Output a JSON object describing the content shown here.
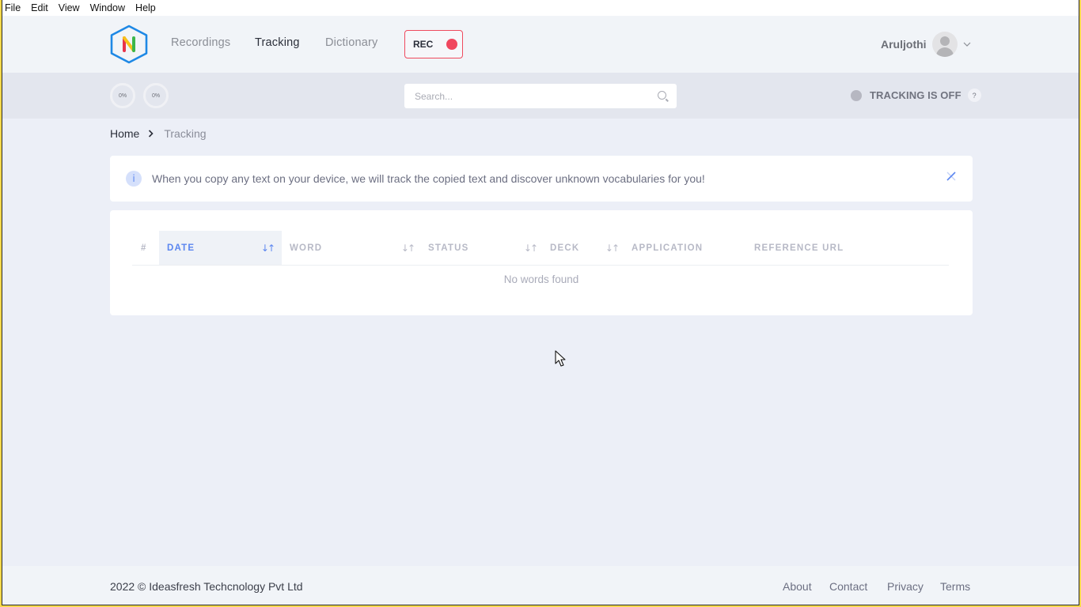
{
  "menubar": {
    "items": [
      "File",
      "Edit",
      "View",
      "Window",
      "Help"
    ]
  },
  "header": {
    "logo_letter": "N",
    "nav": [
      {
        "label": "Recordings",
        "active": false
      },
      {
        "label": "Tracking",
        "active": true
      },
      {
        "label": "Dictionary",
        "active": false
      }
    ],
    "rec_label": "REC",
    "user_name": "Aruljothi"
  },
  "subbar": {
    "progress": [
      {
        "label": "0%",
        "value": 0
      },
      {
        "label": "0%",
        "value": 0
      }
    ],
    "search": {
      "placeholder": "Search...",
      "value": ""
    },
    "tracking_status": "TRACKING IS OFF",
    "help_label": "?"
  },
  "breadcrumb": {
    "home": "Home",
    "current": "Tracking"
  },
  "alert": {
    "icon_label": "i",
    "text": "When you copy any text on your device, we will track the copied text and discover unknown vocabularies for you!"
  },
  "table": {
    "columns": [
      {
        "label": "#",
        "sortable": false,
        "active": false
      },
      {
        "label": "DATE",
        "sortable": true,
        "active": true
      },
      {
        "label": "WORD",
        "sortable": true,
        "active": false
      },
      {
        "label": "STATUS",
        "sortable": true,
        "active": false
      },
      {
        "label": "DECK",
        "sortable": true,
        "active": false
      },
      {
        "label": "APPLICATION",
        "sortable": false,
        "active": false
      },
      {
        "label": "REFERENCE URL",
        "sortable": false,
        "active": false
      }
    ],
    "sort_glyph": "↓↑",
    "rows": [],
    "empty_message": "No words found"
  },
  "footer": {
    "copyright": "2022 © Ideasfresh Techcnology Pvt Ltd",
    "links": [
      "About",
      "Contact",
      "Privacy",
      "Terms"
    ]
  },
  "colors": {
    "accent": "#5b86f0",
    "rec": "#f0475e",
    "logo_border": "#1e88e5"
  }
}
